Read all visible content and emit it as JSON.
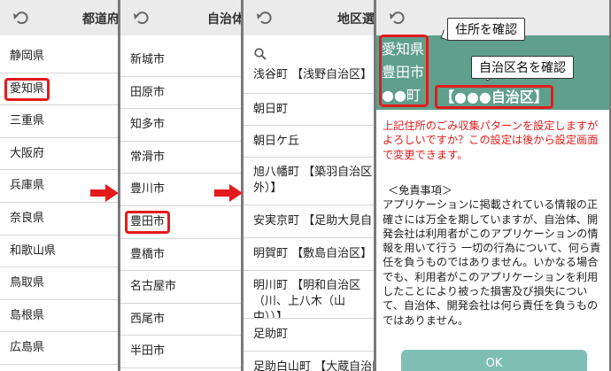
{
  "colors": {
    "accent_green": "#5f9f8c",
    "highlight_red": "#e31b1b",
    "header_gray": "#ebebeb",
    "ok_button": "#7fbfb3"
  },
  "panel1": {
    "title": "都道府",
    "items": [
      "静岡県",
      "愛知県",
      "三重県",
      "大阪府",
      "兵庫県",
      "奈良県",
      "和歌山県",
      "鳥取県",
      "島根県",
      "広島県"
    ],
    "highlighted": "愛知県"
  },
  "panel2": {
    "title": "自治体",
    "items": [
      "新城市",
      "田原市",
      "知多市",
      "常滑市",
      "豊川市",
      "豊田市",
      "豊橋市",
      "名古屋市",
      "西尾市",
      "半田市"
    ],
    "highlighted": "豊田市"
  },
  "panel3": {
    "title": "地区選",
    "search_icon": "search-icon",
    "items": [
      "浅谷町 【浅野自治区】",
      "朝日町",
      "朝日ケ丘",
      "旭八幡町 【築羽自治区外）】",
      "安実京町 【足助大見自",
      "明賀町 【敷島自治区】",
      "明川町 【明和自治区（川、上八木（山中））】",
      "足助町",
      "足助白山町 【大蔵自治区"
    ]
  },
  "panel4": {
    "addr_pref": "愛知県",
    "addr_city": "豊田市",
    "addr_town": "●●町",
    "area_name": "【●●●自治区】",
    "callout_address": "住所を確認",
    "callout_area": "自治区名を確認",
    "confirm_text": "上記住所のごみ収集パターンを設定しますがよろしいですか？この設定は後から設定画面で変更できます。",
    "disclaimer_title": "＜免責事項＞",
    "disclaimer_body": "アプリケーションに掲載されている情報の正確さには万全を期していますが、自治体、開発会社は利用者がこのアプリケーションの情報を用いて行う 一切の行為について、何ら責任を負うものではありません。いかなる場合でも、利用者がこのアプリケーションを利用したことにより被った損害及び損失について、自治体、開発会社は何ら責任を負うものではありません。",
    "ok_label": "OK"
  }
}
